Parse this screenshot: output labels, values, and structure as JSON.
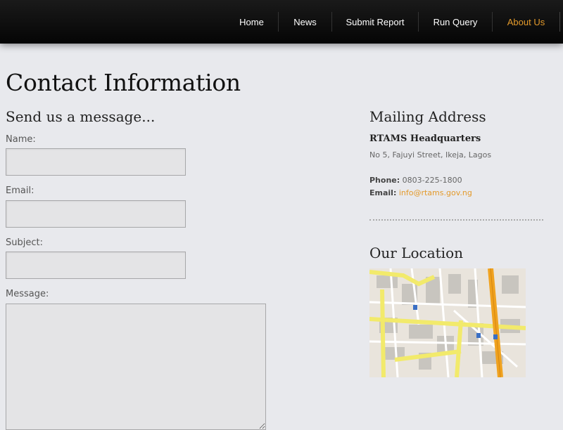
{
  "nav": {
    "items": [
      {
        "label": "Home"
      },
      {
        "label": "News"
      },
      {
        "label": "Submit Report"
      },
      {
        "label": "Run Query"
      },
      {
        "label": "About Us"
      }
    ]
  },
  "page": {
    "title": "Contact Information"
  },
  "form": {
    "heading": "Send us a message...",
    "name_label": "Name:",
    "email_label": "Email:",
    "subject_label": "Subject:",
    "message_label": "Message:"
  },
  "mailing": {
    "heading": "Mailing Address",
    "org": "RTAMS Headquarters",
    "address": "No 5, Fajuyi Street, Ikeja, Lagos",
    "phone_label": "Phone:",
    "phone": "0803-225-1800",
    "email_label": "Email:",
    "email": "info@rtams.gov.ng"
  },
  "location": {
    "heading": "Our Location",
    "map_icon": "map-thumbnail"
  },
  "colors": {
    "accent": "#e39a2b",
    "background": "#e8e9ed",
    "header": "#0b0b0b"
  }
}
